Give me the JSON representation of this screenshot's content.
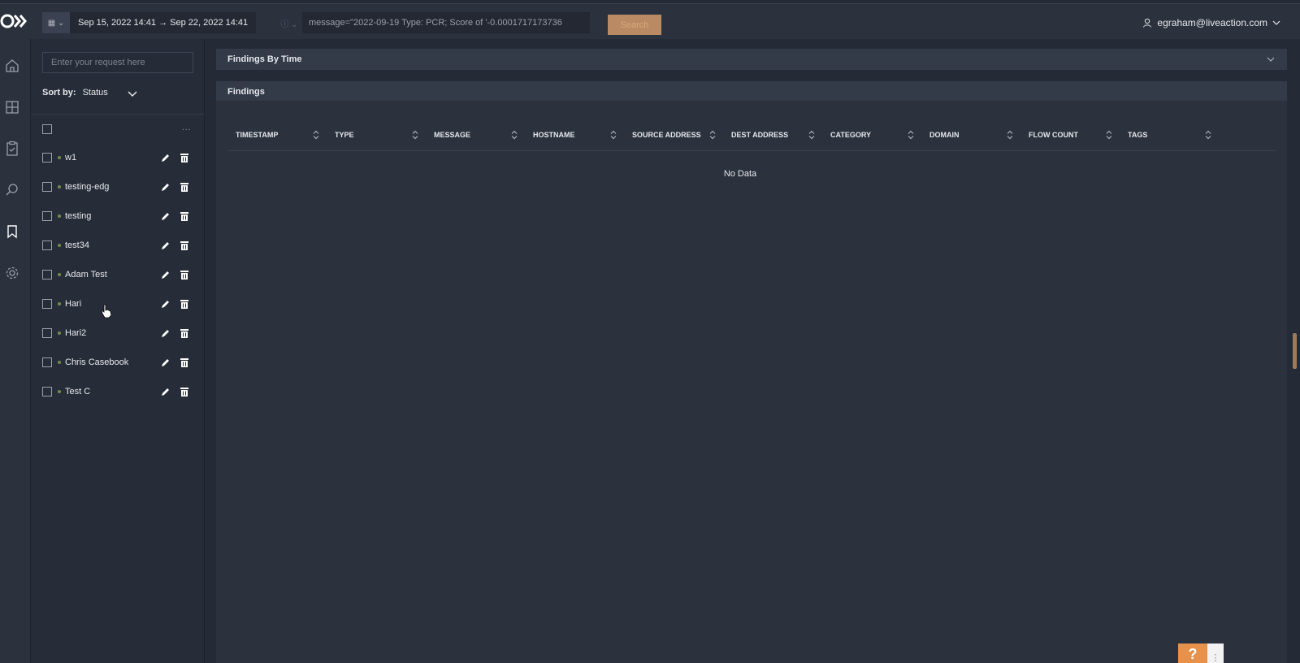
{
  "header": {
    "date_range": "Sep 15, 2022 14:41  →  Sep 22, 2022 14:41",
    "query": "message=\"2022-09-19 Type: PCR; Score of '-0.0001717173736",
    "search_label": "Search",
    "user_email": "egraham@liveaction.com"
  },
  "sidebar": {
    "request_placeholder": "Enter your request here",
    "sort_label": "Sort by:",
    "sort_value": "Status",
    "more": "...",
    "items": [
      {
        "label": "w1"
      },
      {
        "label": "testing-edg"
      },
      {
        "label": "testing"
      },
      {
        "label": "test34"
      },
      {
        "label": "Adam Test"
      },
      {
        "label": "Hari"
      },
      {
        "label": "Hari2"
      },
      {
        "label": "Chris Casebook"
      },
      {
        "label": "Test C"
      }
    ]
  },
  "main": {
    "findings_by_time_title": "Findings By Time",
    "findings_title": "Findings",
    "columns": [
      "TIMESTAMP",
      "TYPE",
      "MESSAGE",
      "HOSTNAME",
      "SOURCE ADDRESS",
      "DEST ADDRESS",
      "CATEGORY",
      "DOMAIN",
      "FLOW COUNT",
      "TAGS"
    ],
    "empty_text": "No Data"
  },
  "help": {
    "label": "?",
    "more": "⋮"
  },
  "colors": {
    "accent": "#e8914a",
    "search_button": "#b98a63",
    "status_dot": "#6f8c4a"
  }
}
